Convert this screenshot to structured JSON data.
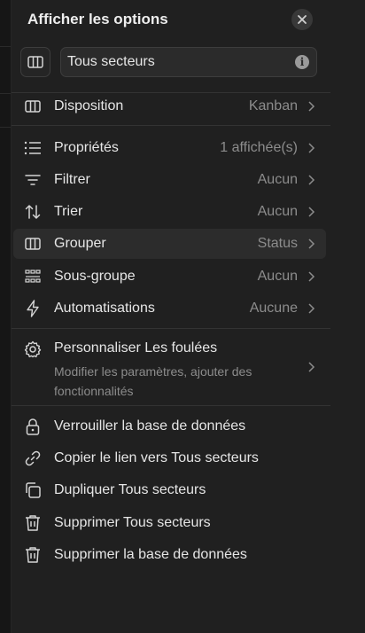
{
  "panel": {
    "title": "Afficher les options",
    "view_name": "Tous secteurs"
  },
  "layout_item": {
    "label": "Disposition",
    "value": "Kanban"
  },
  "settings": [
    {
      "name": "properties",
      "label": "Propriétés",
      "value": "1 affichée(s)",
      "icon": "list-icon"
    },
    {
      "name": "filter",
      "label": "Filtrer",
      "value": "Aucun",
      "icon": "filter-icon"
    },
    {
      "name": "sort",
      "label": "Trier",
      "value": "Aucun",
      "icon": "sort-arrows-icon"
    },
    {
      "name": "group",
      "label": "Grouper",
      "value": "Status",
      "icon": "board-columns-icon"
    },
    {
      "name": "subgroup",
      "label": "Sous-groupe",
      "value": "Aucun",
      "icon": "grid-dots-icon"
    },
    {
      "name": "automations",
      "label": "Automatisations",
      "value": "Aucune",
      "icon": "lightning-icon"
    }
  ],
  "customize": {
    "label": "Personnaliser Les foulées",
    "description": "Modifier les paramètres, ajouter des fonctionnalités"
  },
  "actions": [
    {
      "name": "lock-database",
      "label": "Verrouiller la base de données",
      "icon": "lock-icon"
    },
    {
      "name": "copy-link",
      "label": "Copier le lien vers Tous secteurs",
      "icon": "link-icon"
    },
    {
      "name": "duplicate-view",
      "label": "Dupliquer Tous secteurs",
      "icon": "duplicate-icon"
    },
    {
      "name": "delete-view",
      "label": "Supprimer Tous secteurs",
      "icon": "trash-icon"
    },
    {
      "name": "delete-database",
      "label": "Supprimer la base de données",
      "icon": "trash-icon"
    }
  ],
  "colors": {
    "panel_bg": "#202020",
    "active_row_bg": "#2c2c2c",
    "text": "#e6e6e6",
    "muted_text": "#8c8c8c"
  }
}
